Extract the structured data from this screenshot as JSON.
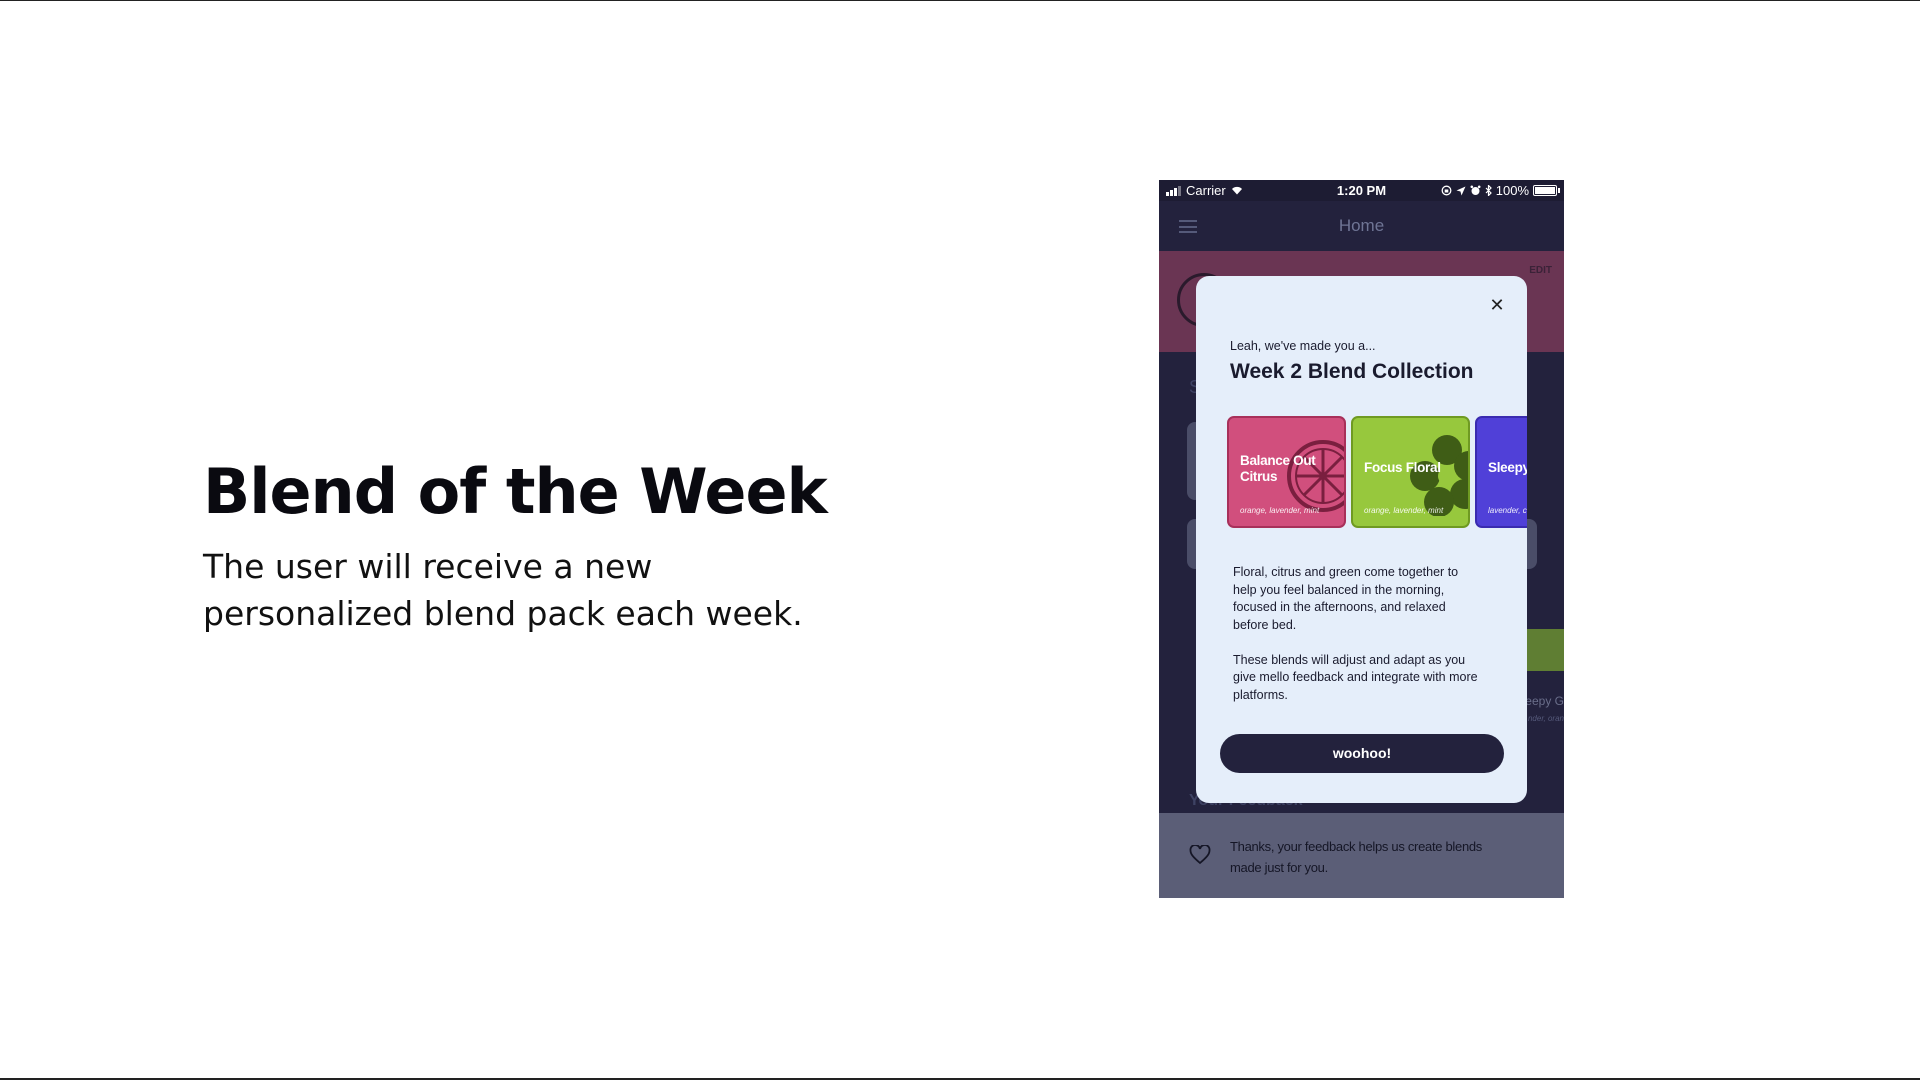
{
  "slide": {
    "title": "Blend of the Week",
    "subtitle": "The user will receive a new personalized blend pack each week."
  },
  "status_bar": {
    "carrier": "Carrier",
    "time": "1:20 PM",
    "battery": "100%",
    "icons": [
      "signal-icon",
      "wifi-icon",
      "lock-rotation-icon",
      "location-icon",
      "alarm-icon",
      "bluetooth-icon",
      "battery-icon"
    ]
  },
  "nav": {
    "title": "Home",
    "menu_icon": "hamburger-menu-icon"
  },
  "background": {
    "edit_label": "EDIT",
    "section_letter": "S",
    "sleepy_label": "eepy G",
    "sleepy_sub": "nder, oran",
    "section_heading": "Your Feedback",
    "feedback_text": "Thanks, your feedback helps us create blends made just for you."
  },
  "modal": {
    "eyebrow": "Leah, we've made you a...",
    "title": "Week 2 Blend Collection",
    "cards": [
      {
        "name": "Balance Out Citrus",
        "ingredients": "orange, lavender, mint",
        "color": "#d14f7d",
        "icon": "citrus-slice-icon"
      },
      {
        "name": "Focus Floral",
        "ingredients": "orange, lavender, mint",
        "color": "#97c83d",
        "icon": "flower-icon"
      },
      {
        "name": "Sleepy",
        "ingredients": "lavender, c",
        "color": "#5040d8",
        "icon": ""
      }
    ],
    "description_1": "Floral, citrus and green come together to help you feel balanced in the morning, focused in the afternoons, and relaxed before bed.",
    "description_2": "These blends will adjust and adapt as you give mello feedback and integrate with more platforms.",
    "cta_label": "woohoo!",
    "close_icon": "close-icon"
  }
}
